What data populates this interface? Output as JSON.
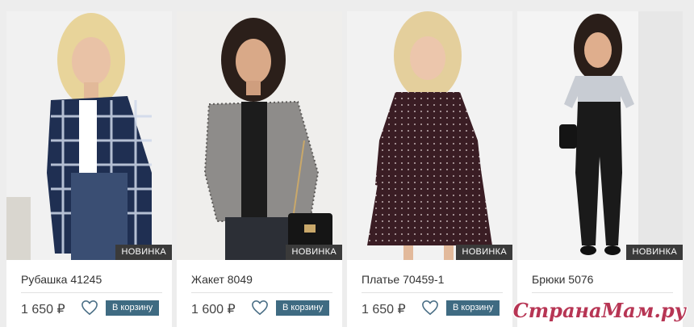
{
  "badge_label": "НОВИНКА",
  "cart_label": "В корзину",
  "products": [
    {
      "title": "Рубашка 41245",
      "price": "1 650 ₽",
      "image": "plaid-shirt-photo"
    },
    {
      "title": "Жакет 8049",
      "price": "1 600 ₽",
      "image": "tweed-jacket-photo"
    },
    {
      "title": "Платье 70459-1",
      "price": "1 650 ₽",
      "image": "polka-dot-dress-photo"
    },
    {
      "title": "Брюки 5076",
      "price": "",
      "image": "leather-pants-photo"
    }
  ],
  "watermark": "СтранаМам.ру",
  "colors": {
    "cart_button": "#3f6b82",
    "badge": "#3a3a3a",
    "watermark": "#b73554"
  }
}
